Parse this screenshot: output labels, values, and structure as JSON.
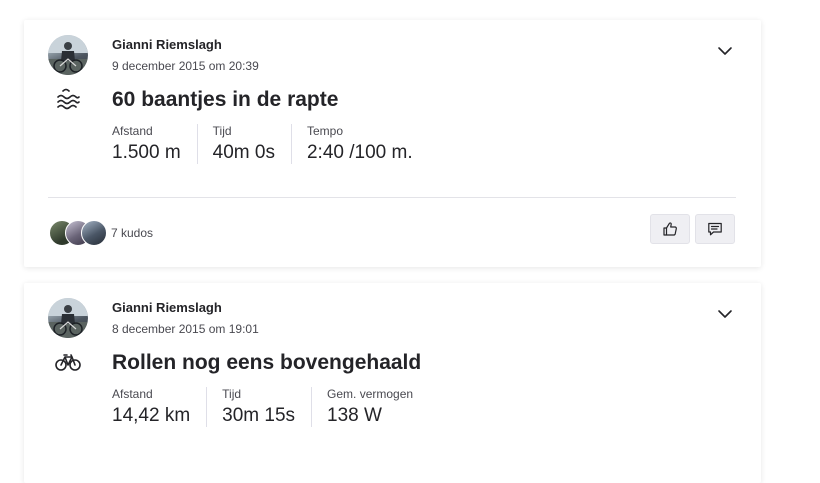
{
  "feed": {
    "activities": [
      {
        "athlete_name": "Gianni Riemslagh",
        "date": "9 december 2015 om 20:39",
        "sport_icon": "swim-icon",
        "title": "60 baantjes in de rapte",
        "stats": [
          {
            "label": "Afstand",
            "value": "1.500 m"
          },
          {
            "label": "Tijd",
            "value": "40m 0s"
          },
          {
            "label": "Tempo",
            "value": "2:40 /100 m."
          }
        ],
        "kudos_count": "7 kudos",
        "kudo_button_icon": "thumbs-up-icon",
        "comment_button_icon": "comment-icon",
        "menu_icon": "chevron-down-icon"
      },
      {
        "athlete_name": "Gianni Riemslagh",
        "date": "8 december 2015 om 19:01",
        "sport_icon": "bike-icon",
        "title": "Rollen nog eens bovengehaald",
        "stats": [
          {
            "label": "Afstand",
            "value": "14,42 km"
          },
          {
            "label": "Tijd",
            "value": "30m 15s"
          },
          {
            "label": "Gem. vermogen",
            "value": "138 W"
          }
        ],
        "menu_icon": "chevron-down-icon"
      }
    ]
  },
  "colors": {
    "text_primary": "#242428",
    "text_secondary": "#494950",
    "button_bg": "#efeff3",
    "divider": "#e3e3e8"
  }
}
